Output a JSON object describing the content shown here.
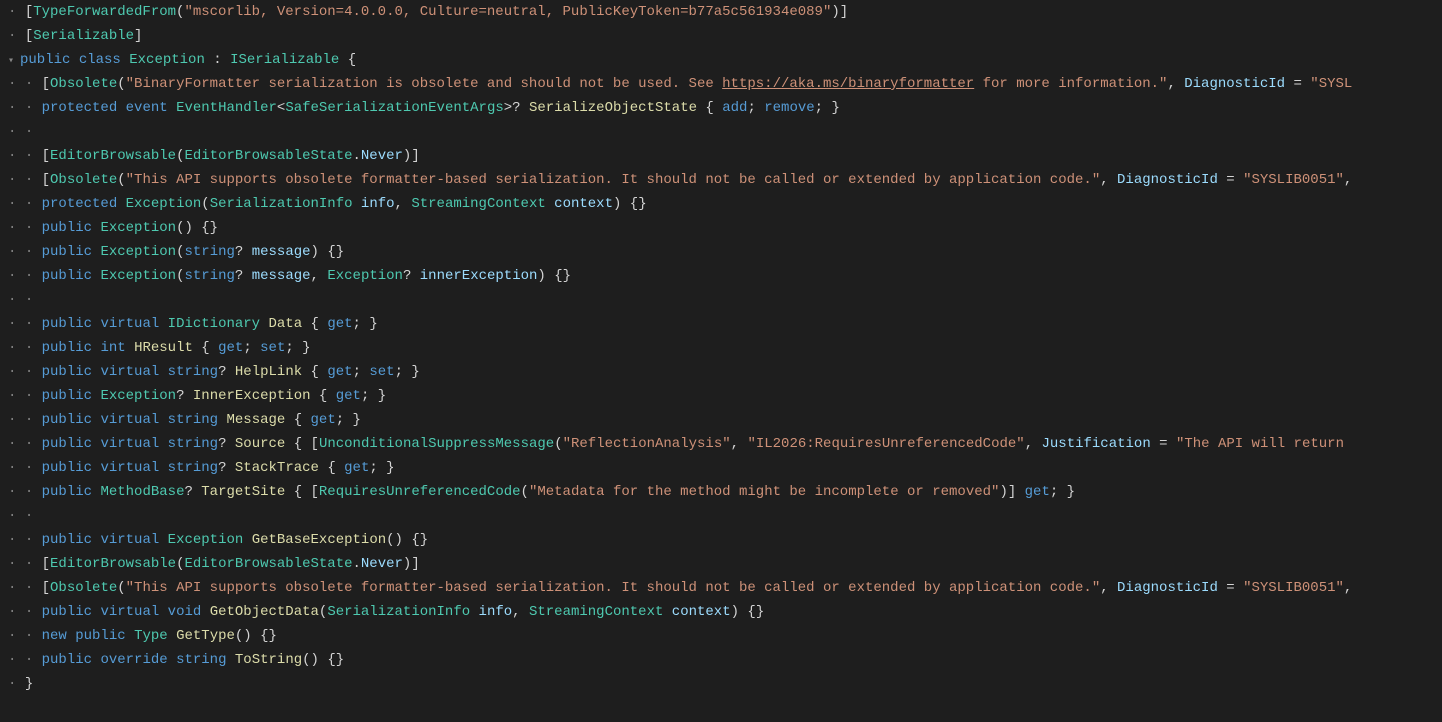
{
  "lines": [
    {
      "indent": 1,
      "tokens": [
        {
          "t": "punct",
          "v": "["
        },
        {
          "t": "type",
          "v": "TypeForwardedFrom"
        },
        {
          "t": "punct",
          "v": "("
        },
        {
          "t": "string",
          "v": "\"mscorlib, Version=4.0.0.0, Culture=neutral, PublicKeyToken=b77a5c561934e089\""
        },
        {
          "t": "punct",
          "v": ")]"
        }
      ]
    },
    {
      "indent": 1,
      "tokens": [
        {
          "t": "punct",
          "v": "["
        },
        {
          "t": "type",
          "v": "Serializable"
        },
        {
          "t": "punct",
          "v": "]"
        }
      ]
    },
    {
      "indent": 1,
      "fold": true,
      "tokens": [
        {
          "t": "kw",
          "v": "public"
        },
        {
          "t": "punct",
          "v": " "
        },
        {
          "t": "kw",
          "v": "class"
        },
        {
          "t": "punct",
          "v": " "
        },
        {
          "t": "type",
          "v": "Exception"
        },
        {
          "t": "punct",
          "v": " : "
        },
        {
          "t": "type",
          "v": "ISerializable"
        },
        {
          "t": "punct",
          "v": " {"
        }
      ]
    },
    {
      "indent": 2,
      "tokens": [
        {
          "t": "punct",
          "v": "["
        },
        {
          "t": "type",
          "v": "Obsolete"
        },
        {
          "t": "punct",
          "v": "("
        },
        {
          "t": "string",
          "v": "\"BinaryFormatter serialization is obsolete and should not be used. See "
        },
        {
          "t": "link",
          "v": "https://aka.ms/binaryformatter"
        },
        {
          "t": "string",
          "v": " for more information.\""
        },
        {
          "t": "punct",
          "v": ", "
        },
        {
          "t": "param",
          "v": "DiagnosticId"
        },
        {
          "t": "punct",
          "v": " = "
        },
        {
          "t": "string",
          "v": "\"SYSL"
        }
      ]
    },
    {
      "indent": 2,
      "tokens": [
        {
          "t": "kw",
          "v": "protected"
        },
        {
          "t": "punct",
          "v": " "
        },
        {
          "t": "kw",
          "v": "event"
        },
        {
          "t": "punct",
          "v": " "
        },
        {
          "t": "type",
          "v": "EventHandler"
        },
        {
          "t": "punct",
          "v": "<"
        },
        {
          "t": "type",
          "v": "SafeSerializationEventArgs"
        },
        {
          "t": "punct",
          "v": ">? "
        },
        {
          "t": "method",
          "v": "SerializeObjectState"
        },
        {
          "t": "punct",
          "v": " { "
        },
        {
          "t": "kw",
          "v": "add"
        },
        {
          "t": "punct",
          "v": "; "
        },
        {
          "t": "kw",
          "v": "remove"
        },
        {
          "t": "punct",
          "v": "; }"
        }
      ]
    },
    {
      "indent": 2,
      "tokens": []
    },
    {
      "indent": 2,
      "tokens": [
        {
          "t": "punct",
          "v": "["
        },
        {
          "t": "type",
          "v": "EditorBrowsable"
        },
        {
          "t": "punct",
          "v": "("
        },
        {
          "t": "type",
          "v": "EditorBrowsableState"
        },
        {
          "t": "punct",
          "v": "."
        },
        {
          "t": "param",
          "v": "Never"
        },
        {
          "t": "punct",
          "v": ")]"
        }
      ]
    },
    {
      "indent": 2,
      "tokens": [
        {
          "t": "punct",
          "v": "["
        },
        {
          "t": "type",
          "v": "Obsolete"
        },
        {
          "t": "punct",
          "v": "("
        },
        {
          "t": "string",
          "v": "\"This API supports obsolete formatter-based serialization. It should not be called or extended by application code.\""
        },
        {
          "t": "punct",
          "v": ", "
        },
        {
          "t": "param",
          "v": "DiagnosticId"
        },
        {
          "t": "punct",
          "v": " = "
        },
        {
          "t": "string",
          "v": "\"SYSLIB0051\""
        },
        {
          "t": "punct",
          "v": ","
        }
      ]
    },
    {
      "indent": 2,
      "tokens": [
        {
          "t": "kw",
          "v": "protected"
        },
        {
          "t": "punct",
          "v": " "
        },
        {
          "t": "type",
          "v": "Exception"
        },
        {
          "t": "punct",
          "v": "("
        },
        {
          "t": "type",
          "v": "SerializationInfo"
        },
        {
          "t": "punct",
          "v": " "
        },
        {
          "t": "param",
          "v": "info"
        },
        {
          "t": "punct",
          "v": ", "
        },
        {
          "t": "type",
          "v": "StreamingContext"
        },
        {
          "t": "punct",
          "v": " "
        },
        {
          "t": "param",
          "v": "context"
        },
        {
          "t": "punct",
          "v": ") {}"
        }
      ]
    },
    {
      "indent": 2,
      "tokens": [
        {
          "t": "kw",
          "v": "public"
        },
        {
          "t": "punct",
          "v": " "
        },
        {
          "t": "type",
          "v": "Exception"
        },
        {
          "t": "punct",
          "v": "() {}"
        }
      ]
    },
    {
      "indent": 2,
      "tokens": [
        {
          "t": "kw",
          "v": "public"
        },
        {
          "t": "punct",
          "v": " "
        },
        {
          "t": "type",
          "v": "Exception"
        },
        {
          "t": "punct",
          "v": "("
        },
        {
          "t": "kw",
          "v": "string"
        },
        {
          "t": "punct",
          "v": "? "
        },
        {
          "t": "param",
          "v": "message"
        },
        {
          "t": "punct",
          "v": ") {}"
        }
      ]
    },
    {
      "indent": 2,
      "tokens": [
        {
          "t": "kw",
          "v": "public"
        },
        {
          "t": "punct",
          "v": " "
        },
        {
          "t": "type",
          "v": "Exception"
        },
        {
          "t": "punct",
          "v": "("
        },
        {
          "t": "kw",
          "v": "string"
        },
        {
          "t": "punct",
          "v": "? "
        },
        {
          "t": "param",
          "v": "message"
        },
        {
          "t": "punct",
          "v": ", "
        },
        {
          "t": "type",
          "v": "Exception"
        },
        {
          "t": "punct",
          "v": "? "
        },
        {
          "t": "param",
          "v": "innerException"
        },
        {
          "t": "punct",
          "v": ") {}"
        }
      ]
    },
    {
      "indent": 2,
      "tokens": []
    },
    {
      "indent": 2,
      "tokens": [
        {
          "t": "kw",
          "v": "public"
        },
        {
          "t": "punct",
          "v": " "
        },
        {
          "t": "kw",
          "v": "virtual"
        },
        {
          "t": "punct",
          "v": " "
        },
        {
          "t": "type",
          "v": "IDictionary"
        },
        {
          "t": "punct",
          "v": " "
        },
        {
          "t": "method",
          "v": "Data"
        },
        {
          "t": "punct",
          "v": " { "
        },
        {
          "t": "kw",
          "v": "get"
        },
        {
          "t": "punct",
          "v": "; }"
        }
      ]
    },
    {
      "indent": 2,
      "tokens": [
        {
          "t": "kw",
          "v": "public"
        },
        {
          "t": "punct",
          "v": " "
        },
        {
          "t": "kw",
          "v": "int"
        },
        {
          "t": "punct",
          "v": " "
        },
        {
          "t": "method",
          "v": "HResult"
        },
        {
          "t": "punct",
          "v": " { "
        },
        {
          "t": "kw",
          "v": "get"
        },
        {
          "t": "punct",
          "v": "; "
        },
        {
          "t": "kw",
          "v": "set"
        },
        {
          "t": "punct",
          "v": "; }"
        }
      ]
    },
    {
      "indent": 2,
      "tokens": [
        {
          "t": "kw",
          "v": "public"
        },
        {
          "t": "punct",
          "v": " "
        },
        {
          "t": "kw",
          "v": "virtual"
        },
        {
          "t": "punct",
          "v": " "
        },
        {
          "t": "kw",
          "v": "string"
        },
        {
          "t": "punct",
          "v": "? "
        },
        {
          "t": "method",
          "v": "HelpLink"
        },
        {
          "t": "punct",
          "v": " { "
        },
        {
          "t": "kw",
          "v": "get"
        },
        {
          "t": "punct",
          "v": "; "
        },
        {
          "t": "kw",
          "v": "set"
        },
        {
          "t": "punct",
          "v": "; }"
        }
      ]
    },
    {
      "indent": 2,
      "tokens": [
        {
          "t": "kw",
          "v": "public"
        },
        {
          "t": "punct",
          "v": " "
        },
        {
          "t": "type",
          "v": "Exception"
        },
        {
          "t": "punct",
          "v": "? "
        },
        {
          "t": "method",
          "v": "InnerException"
        },
        {
          "t": "punct",
          "v": " { "
        },
        {
          "t": "kw",
          "v": "get"
        },
        {
          "t": "punct",
          "v": "; }"
        }
      ]
    },
    {
      "indent": 2,
      "tokens": [
        {
          "t": "kw",
          "v": "public"
        },
        {
          "t": "punct",
          "v": " "
        },
        {
          "t": "kw",
          "v": "virtual"
        },
        {
          "t": "punct",
          "v": " "
        },
        {
          "t": "kw",
          "v": "string"
        },
        {
          "t": "punct",
          "v": " "
        },
        {
          "t": "method",
          "v": "Message"
        },
        {
          "t": "punct",
          "v": " { "
        },
        {
          "t": "kw",
          "v": "get"
        },
        {
          "t": "punct",
          "v": "; }"
        }
      ]
    },
    {
      "indent": 2,
      "tokens": [
        {
          "t": "kw",
          "v": "public"
        },
        {
          "t": "punct",
          "v": " "
        },
        {
          "t": "kw",
          "v": "virtual"
        },
        {
          "t": "punct",
          "v": " "
        },
        {
          "t": "kw",
          "v": "string"
        },
        {
          "t": "punct",
          "v": "? "
        },
        {
          "t": "method",
          "v": "Source"
        },
        {
          "t": "punct",
          "v": " { ["
        },
        {
          "t": "type",
          "v": "UnconditionalSuppressMessage"
        },
        {
          "t": "punct",
          "v": "("
        },
        {
          "t": "string",
          "v": "\"ReflectionAnalysis\""
        },
        {
          "t": "punct",
          "v": ", "
        },
        {
          "t": "string",
          "v": "\"IL2026:RequiresUnreferencedCode\""
        },
        {
          "t": "punct",
          "v": ", "
        },
        {
          "t": "param",
          "v": "Justification"
        },
        {
          "t": "punct",
          "v": " = "
        },
        {
          "t": "string",
          "v": "\"The API will return "
        }
      ]
    },
    {
      "indent": 2,
      "tokens": [
        {
          "t": "kw",
          "v": "public"
        },
        {
          "t": "punct",
          "v": " "
        },
        {
          "t": "kw",
          "v": "virtual"
        },
        {
          "t": "punct",
          "v": " "
        },
        {
          "t": "kw",
          "v": "string"
        },
        {
          "t": "punct",
          "v": "? "
        },
        {
          "t": "method",
          "v": "StackTrace"
        },
        {
          "t": "punct",
          "v": " { "
        },
        {
          "t": "kw",
          "v": "get"
        },
        {
          "t": "punct",
          "v": "; }"
        }
      ]
    },
    {
      "indent": 2,
      "tokens": [
        {
          "t": "kw",
          "v": "public"
        },
        {
          "t": "punct",
          "v": " "
        },
        {
          "t": "type",
          "v": "MethodBase"
        },
        {
          "t": "punct",
          "v": "? "
        },
        {
          "t": "method",
          "v": "TargetSite"
        },
        {
          "t": "punct",
          "v": " { ["
        },
        {
          "t": "type",
          "v": "RequiresUnreferencedCode"
        },
        {
          "t": "punct",
          "v": "("
        },
        {
          "t": "string",
          "v": "\"Metadata for the method might be incomplete or removed\""
        },
        {
          "t": "punct",
          "v": ")] "
        },
        {
          "t": "kw",
          "v": "get"
        },
        {
          "t": "punct",
          "v": "; }"
        }
      ]
    },
    {
      "indent": 2,
      "tokens": []
    },
    {
      "indent": 2,
      "tokens": [
        {
          "t": "kw",
          "v": "public"
        },
        {
          "t": "punct",
          "v": " "
        },
        {
          "t": "kw",
          "v": "virtual"
        },
        {
          "t": "punct",
          "v": " "
        },
        {
          "t": "type",
          "v": "Exception"
        },
        {
          "t": "punct",
          "v": " "
        },
        {
          "t": "method",
          "v": "GetBaseException"
        },
        {
          "t": "punct",
          "v": "() {}"
        }
      ]
    },
    {
      "indent": 2,
      "tokens": [
        {
          "t": "punct",
          "v": "["
        },
        {
          "t": "type",
          "v": "EditorBrowsable"
        },
        {
          "t": "punct",
          "v": "("
        },
        {
          "t": "type",
          "v": "EditorBrowsableState"
        },
        {
          "t": "punct",
          "v": "."
        },
        {
          "t": "param",
          "v": "Never"
        },
        {
          "t": "punct",
          "v": ")]"
        }
      ]
    },
    {
      "indent": 2,
      "tokens": [
        {
          "t": "punct",
          "v": "["
        },
        {
          "t": "type",
          "v": "Obsolete"
        },
        {
          "t": "punct",
          "v": "("
        },
        {
          "t": "string",
          "v": "\"This API supports obsolete formatter-based serialization. It should not be called or extended by application code.\""
        },
        {
          "t": "punct",
          "v": ", "
        },
        {
          "t": "param",
          "v": "DiagnosticId"
        },
        {
          "t": "punct",
          "v": " = "
        },
        {
          "t": "string",
          "v": "\"SYSLIB0051\""
        },
        {
          "t": "punct",
          "v": ","
        }
      ]
    },
    {
      "indent": 2,
      "tokens": [
        {
          "t": "kw",
          "v": "public"
        },
        {
          "t": "punct",
          "v": " "
        },
        {
          "t": "kw",
          "v": "virtual"
        },
        {
          "t": "punct",
          "v": " "
        },
        {
          "t": "kw",
          "v": "void"
        },
        {
          "t": "punct",
          "v": " "
        },
        {
          "t": "method",
          "v": "GetObjectData"
        },
        {
          "t": "punct",
          "v": "("
        },
        {
          "t": "type",
          "v": "SerializationInfo"
        },
        {
          "t": "punct",
          "v": " "
        },
        {
          "t": "param",
          "v": "info"
        },
        {
          "t": "punct",
          "v": ", "
        },
        {
          "t": "type",
          "v": "StreamingContext"
        },
        {
          "t": "punct",
          "v": " "
        },
        {
          "t": "param",
          "v": "context"
        },
        {
          "t": "punct",
          "v": ") {}"
        }
      ]
    },
    {
      "indent": 2,
      "tokens": [
        {
          "t": "kw",
          "v": "new"
        },
        {
          "t": "punct",
          "v": " "
        },
        {
          "t": "kw",
          "v": "public"
        },
        {
          "t": "punct",
          "v": " "
        },
        {
          "t": "type",
          "v": "Type"
        },
        {
          "t": "punct",
          "v": " "
        },
        {
          "t": "method",
          "v": "GetType"
        },
        {
          "t": "punct",
          "v": "() {}"
        }
      ]
    },
    {
      "indent": 2,
      "tokens": [
        {
          "t": "kw",
          "v": "public"
        },
        {
          "t": "punct",
          "v": " "
        },
        {
          "t": "kw",
          "v": "override"
        },
        {
          "t": "punct",
          "v": " "
        },
        {
          "t": "kw",
          "v": "string"
        },
        {
          "t": "punct",
          "v": " "
        },
        {
          "t": "method",
          "v": "ToString"
        },
        {
          "t": "punct",
          "v": "() {}"
        }
      ]
    },
    {
      "indent": 1,
      "tokens": [
        {
          "t": "punct",
          "v": "}"
        }
      ]
    }
  ]
}
